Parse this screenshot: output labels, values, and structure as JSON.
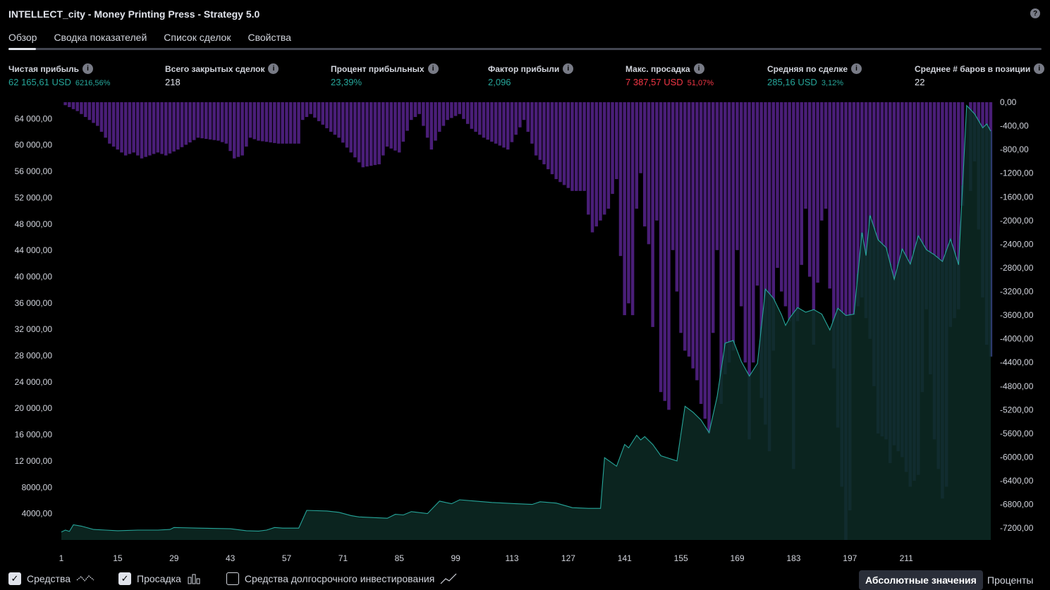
{
  "title": "INTELLECT_city - Money Printing Press - Strategy 5.0",
  "help_icon": "?",
  "tabs": [
    {
      "label": "Обзор",
      "active": true
    },
    {
      "label": "Сводка показателей",
      "active": false
    },
    {
      "label": "Список сделок",
      "active": false
    },
    {
      "label": "Свойства",
      "active": false
    }
  ],
  "metrics": [
    {
      "label": "Чистая прибыль",
      "value": "62 165,61 USD",
      "sub": "6216,56%",
      "color": "pos"
    },
    {
      "label": "Всего закрытых сделок",
      "value": "218",
      "sub": "",
      "color": "neutral"
    },
    {
      "label": "Процент прибыльных",
      "value": "23,39%",
      "sub": "",
      "color": "pos"
    },
    {
      "label": "Фактор прибыли",
      "value": "2,096",
      "sub": "",
      "color": "pos"
    },
    {
      "label": "Макс. просадка",
      "value": "7 387,57 USD",
      "sub": "51,07%",
      "color": "neg"
    },
    {
      "label": "Средняя по сделке",
      "value": "285,16 USD",
      "sub": "3,12%",
      "color": "pos"
    },
    {
      "label": "Среднее # баров в позиции",
      "value": "22",
      "sub": "",
      "color": "neutral"
    }
  ],
  "legend": {
    "equity": {
      "label": "Средства",
      "checked": true
    },
    "drawdown": {
      "label": "Просадка",
      "checked": true
    },
    "buyhold": {
      "label": "Средства долгосрочного инвестирования",
      "checked": false
    }
  },
  "modes": {
    "absolute": "Абсолютные значения",
    "percent": "Проценты"
  },
  "colors": {
    "equity_line": "#26a69a",
    "equity_fill": "#0d2a24",
    "drawdown_bar": "#4a1e78",
    "drawdown_bar_overlap": "#2f3d73"
  },
  "chart_data": {
    "type": "area",
    "x_ticks": [
      "1",
      "15",
      "29",
      "43",
      "57",
      "71",
      "85",
      "99",
      "113",
      "127",
      "141",
      "155",
      "169",
      "183",
      "197",
      "211"
    ],
    "left_ticks": [
      "64 000,00",
      "60 000,00",
      "56 000,00",
      "52 000,00",
      "48 000,00",
      "44 000,00",
      "40 000,00",
      "36 000,00",
      "32 000,00",
      "28 000,00",
      "24 000,00",
      "20 000,00",
      "16 000,00",
      "12 000,00",
      "8000,00",
      "4000,00"
    ],
    "right_ticks": [
      "0,00",
      "-400,00",
      "-800,00",
      "-1200,00",
      "-1600,00",
      "-2000,00",
      "-2400,00",
      "-2800,00",
      "-3200,00",
      "-3600,00",
      "-4000,00",
      "-4400,00",
      "-4800,00",
      "-5200,00",
      "-5600,00",
      "-6000,00",
      "-6400,00",
      "-6800,00",
      "-7200,00"
    ],
    "left_range": [
      0,
      66500
    ],
    "right_range": [
      -7400,
      0
    ],
    "series": [
      {
        "name": "Средства",
        "type": "area",
        "axis": "left",
        "points": [
          [
            1,
            1200
          ],
          [
            2,
            1500
          ],
          [
            3,
            1300
          ],
          [
            4,
            2300
          ],
          [
            6,
            2100
          ],
          [
            9,
            1600
          ],
          [
            12,
            1500
          ],
          [
            15,
            1400
          ],
          [
            20,
            1500
          ],
          [
            25,
            1500
          ],
          [
            28,
            1600
          ],
          [
            29,
            1900
          ],
          [
            35,
            1800
          ],
          [
            43,
            1700
          ],
          [
            47,
            1400
          ],
          [
            50,
            1350
          ],
          [
            52,
            1500
          ],
          [
            54,
            1900
          ],
          [
            56,
            1800
          ],
          [
            60,
            1800
          ],
          [
            62,
            4500
          ],
          [
            67,
            4400
          ],
          [
            70,
            4200
          ],
          [
            73,
            3700
          ],
          [
            75,
            3500
          ],
          [
            82,
            3300
          ],
          [
            84,
            3900
          ],
          [
            86,
            3800
          ],
          [
            88,
            4300
          ],
          [
            92,
            4000
          ],
          [
            95,
            5900
          ],
          [
            98,
            5500
          ],
          [
            100,
            6100
          ],
          [
            104,
            5900
          ],
          [
            108,
            5700
          ],
          [
            114,
            5500
          ],
          [
            118,
            5400
          ],
          [
            120,
            5800
          ],
          [
            124,
            5600
          ],
          [
            128,
            4900
          ],
          [
            132,
            4800
          ],
          [
            135,
            4800
          ],
          [
            136,
            12500
          ],
          [
            139,
            11200
          ],
          [
            141,
            14500
          ],
          [
            142,
            14000
          ],
          [
            144,
            15900
          ],
          [
            145,
            15200
          ],
          [
            146,
            15700
          ],
          [
            148,
            14500
          ],
          [
            150,
            12800
          ],
          [
            154,
            12000
          ],
          [
            156,
            20300
          ],
          [
            158,
            19400
          ],
          [
            160,
            18200
          ],
          [
            162,
            16300
          ],
          [
            164,
            21800
          ],
          [
            166,
            29900
          ],
          [
            168,
            30300
          ],
          [
            170,
            27100
          ],
          [
            172,
            24900
          ],
          [
            174,
            26800
          ],
          [
            176,
            38100
          ],
          [
            178,
            36700
          ],
          [
            180,
            34200
          ],
          [
            181,
            32600
          ],
          [
            182,
            33700
          ],
          [
            184,
            35300
          ],
          [
            186,
            34600
          ],
          [
            188,
            35000
          ],
          [
            190,
            34300
          ],
          [
            192,
            31900
          ],
          [
            194,
            35200
          ],
          [
            196,
            34100
          ],
          [
            198,
            34300
          ],
          [
            200,
            46700
          ],
          [
            201,
            43200
          ],
          [
            202,
            49300
          ],
          [
            204,
            45600
          ],
          [
            206,
            44400
          ],
          [
            208,
            39600
          ],
          [
            210,
            44200
          ],
          [
            212,
            41900
          ],
          [
            214,
            46200
          ],
          [
            216,
            44100
          ],
          [
            218,
            43300
          ],
          [
            220,
            42300
          ],
          [
            222,
            45700
          ],
          [
            224,
            41800
          ],
          [
            226,
            66000
          ],
          [
            228,
            64700
          ],
          [
            230,
            62600
          ],
          [
            231,
            63200
          ],
          [
            232,
            62100
          ]
        ]
      },
      {
        "name": "Просадка",
        "type": "bar",
        "axis": "right",
        "keypoints": [
          [
            1,
            0
          ],
          [
            2,
            -50
          ],
          [
            5,
            -150
          ],
          [
            8,
            -300
          ],
          [
            10,
            -400
          ],
          [
            12,
            -600
          ],
          [
            13,
            -700
          ],
          [
            15,
            -800
          ],
          [
            17,
            -900
          ],
          [
            19,
            -850
          ],
          [
            21,
            -950
          ],
          [
            23,
            -900
          ],
          [
            25,
            -850
          ],
          [
            27,
            -900
          ],
          [
            30,
            -800
          ],
          [
            35,
            -600
          ],
          [
            40,
            -650
          ],
          [
            42,
            -700
          ],
          [
            44,
            -950
          ],
          [
            46,
            -900
          ],
          [
            48,
            -600
          ],
          [
            50,
            -650
          ],
          [
            55,
            -700
          ],
          [
            60,
            -700
          ],
          [
            61,
            -300
          ],
          [
            63,
            -200
          ],
          [
            68,
            -500
          ],
          [
            70,
            -600
          ],
          [
            73,
            -850
          ],
          [
            76,
            -1100
          ],
          [
            80,
            -1050
          ],
          [
            82,
            -750
          ],
          [
            85,
            -850
          ],
          [
            88,
            -300
          ],
          [
            90,
            -200
          ],
          [
            93,
            -800
          ],
          [
            95,
            -500
          ],
          [
            97,
            -300
          ],
          [
            100,
            -200
          ],
          [
            103,
            -450
          ],
          [
            106,
            -600
          ],
          [
            109,
            -700
          ],
          [
            112,
            -800
          ],
          [
            116,
            -300
          ],
          [
            119,
            -900
          ],
          [
            121,
            -1050
          ],
          [
            124,
            -1300
          ],
          [
            126,
            -1400
          ],
          [
            128,
            -1500
          ],
          [
            131,
            -1500
          ],
          [
            132,
            -1900
          ],
          [
            133,
            -2200
          ],
          [
            135,
            -2000
          ],
          [
            137,
            -1800
          ],
          [
            139,
            -1300
          ],
          [
            140,
            -2600
          ],
          [
            141,
            -3600
          ],
          [
            142,
            -3400
          ],
          [
            143,
            -3600
          ],
          [
            144,
            -1800
          ],
          [
            145,
            -1200
          ],
          [
            146,
            -2100
          ],
          [
            147,
            -2400
          ],
          [
            148,
            -3800
          ],
          [
            149,
            -2000
          ],
          [
            150,
            -4900
          ],
          [
            152,
            -5200
          ],
          [
            153,
            -2500
          ],
          [
            155,
            -3900
          ],
          [
            156,
            -4200
          ],
          [
            157,
            -4300
          ],
          [
            159,
            -4700
          ],
          [
            160,
            -5100
          ],
          [
            162,
            -5600
          ],
          [
            163,
            -3900
          ],
          [
            164,
            -2500
          ],
          [
            165,
            -5100
          ],
          [
            166,
            -4600
          ],
          [
            168,
            -4200
          ],
          [
            169,
            -2500
          ],
          [
            171,
            -4400
          ],
          [
            172,
            -5700
          ],
          [
            174,
            -3100
          ],
          [
            175,
            -5000
          ],
          [
            177,
            -5900
          ],
          [
            178,
            -4200
          ],
          [
            179,
            -2800
          ],
          [
            180,
            -3200
          ],
          [
            182,
            -3700
          ],
          [
            183,
            -6200
          ],
          [
            184,
            -3700
          ],
          [
            186,
            -1800
          ],
          [
            188,
            -4100
          ],
          [
            190,
            -2000
          ],
          [
            191,
            -1800
          ],
          [
            193,
            -4500
          ],
          [
            195,
            -6500
          ],
          [
            196,
            -7400
          ],
          [
            197,
            -6900
          ],
          [
            198,
            -3600
          ],
          [
            200,
            -3300
          ],
          [
            202,
            -4000
          ],
          [
            204,
            -5600
          ],
          [
            206,
            -5700
          ],
          [
            207,
            -6100
          ],
          [
            208,
            -5800
          ],
          [
            210,
            -6000
          ],
          [
            212,
            -6500
          ],
          [
            214,
            -6300
          ],
          [
            216,
            -3500
          ],
          [
            218,
            -5700
          ],
          [
            220,
            -6700
          ],
          [
            221,
            -6500
          ],
          [
            222,
            -3800
          ],
          [
            224,
            -3500
          ],
          [
            226,
            0
          ],
          [
            227,
            -1500
          ],
          [
            228,
            -1000
          ],
          [
            230,
            -3300
          ],
          [
            231,
            -4100
          ],
          [
            232,
            -4300
          ]
        ]
      }
    ]
  }
}
